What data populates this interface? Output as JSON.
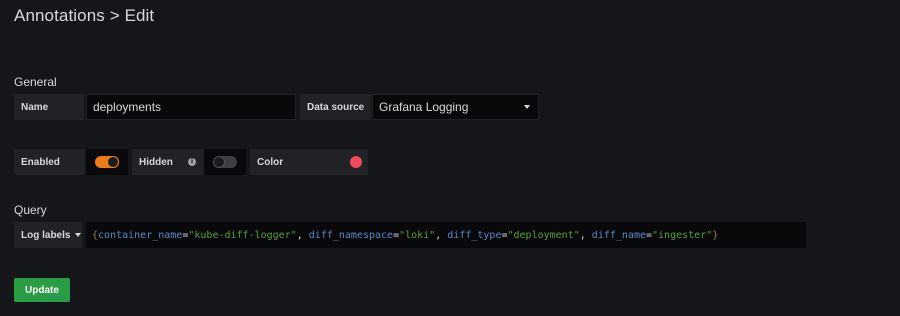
{
  "header": {
    "title": "Annotations > Edit"
  },
  "general": {
    "section_title": "General",
    "name_label": "Name",
    "name_value": "deployments",
    "datasource_label": "Data source",
    "datasource_value": "Grafana Logging",
    "enabled_label": "Enabled",
    "enabled": true,
    "hidden_label": "Hidden",
    "hidden": false,
    "color_label": "Color",
    "color_value": "#f2495c"
  },
  "query": {
    "section_title": "Query",
    "log_labels_button": "Log labels",
    "tokens": [
      {
        "text": "{",
        "kind": "punc"
      },
      {
        "text": "container_name",
        "kind": "key"
      },
      {
        "text": "=",
        "kind": "op"
      },
      {
        "text": "\"kube-diff-logger\"",
        "kind": "str"
      },
      {
        "text": ", ",
        "kind": "op"
      },
      {
        "text": "diff_namespace",
        "kind": "key"
      },
      {
        "text": "=",
        "kind": "op"
      },
      {
        "text": "\"loki\"",
        "kind": "str"
      },
      {
        "text": ", ",
        "kind": "op"
      },
      {
        "text": "diff_type",
        "kind": "key"
      },
      {
        "text": "=",
        "kind": "op"
      },
      {
        "text": "\"deployment\"",
        "kind": "str"
      },
      {
        "text": ", ",
        "kind": "op"
      },
      {
        "text": "diff_name",
        "kind": "key"
      },
      {
        "text": "=",
        "kind": "op"
      },
      {
        "text": "\"ingester\"",
        "kind": "str"
      },
      {
        "text": "}",
        "kind": "punc"
      }
    ]
  },
  "actions": {
    "update_label": "Update",
    "update_color": "#299c46"
  },
  "icons": {
    "info": "info-icon",
    "dropdown": "chevron-down-icon"
  }
}
